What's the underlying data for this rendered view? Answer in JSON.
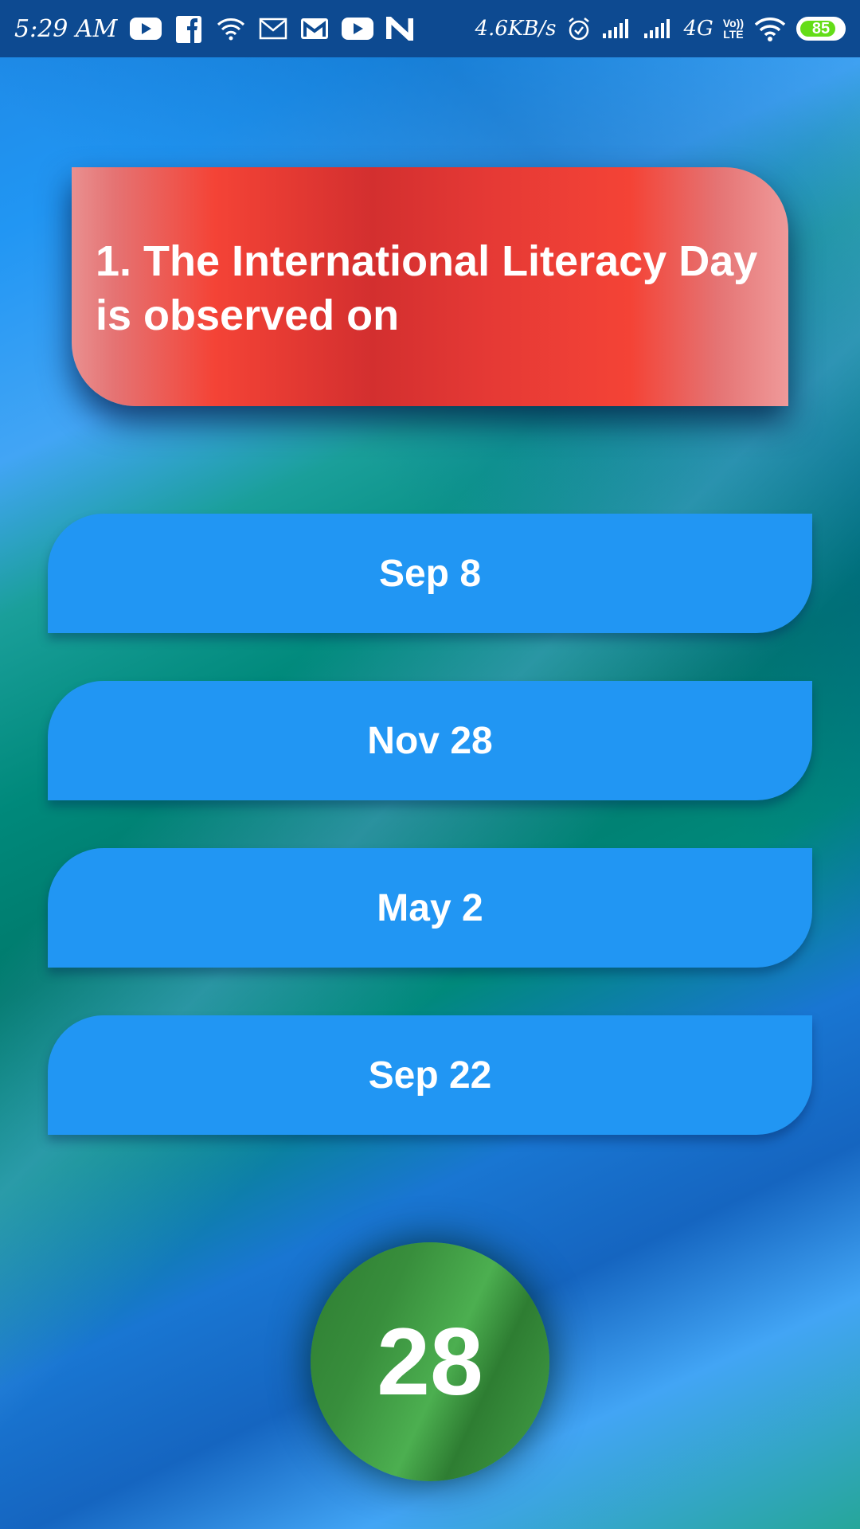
{
  "status_bar": {
    "time": "5:29 AM",
    "network_speed": "4.6KB/s",
    "network_type": "4G",
    "volte_top": "Vo))",
    "volte_bottom": "LTE",
    "battery_level": "85",
    "battery_fraction": 0.85,
    "icons": [
      "youtube-icon",
      "facebook-icon",
      "wifi-icon",
      "mail-icon",
      "gmail-icon",
      "youtube-icon",
      "n-app-icon",
      "alarm-icon",
      "signal-icon",
      "signal-icon",
      "wifi-icon",
      "battery-icon"
    ]
  },
  "quiz": {
    "question": "1. The International Literacy Day is observed on",
    "options": [
      "Sep 8",
      "Nov 28",
      "May 2",
      "Sep 22"
    ],
    "timer": "28"
  },
  "colors": {
    "question_card": "#f44336",
    "option_button": "#2196f3",
    "timer_circle": "#43a047",
    "status_bar": "#0d4a91",
    "battery_fill": "#64dd17"
  }
}
